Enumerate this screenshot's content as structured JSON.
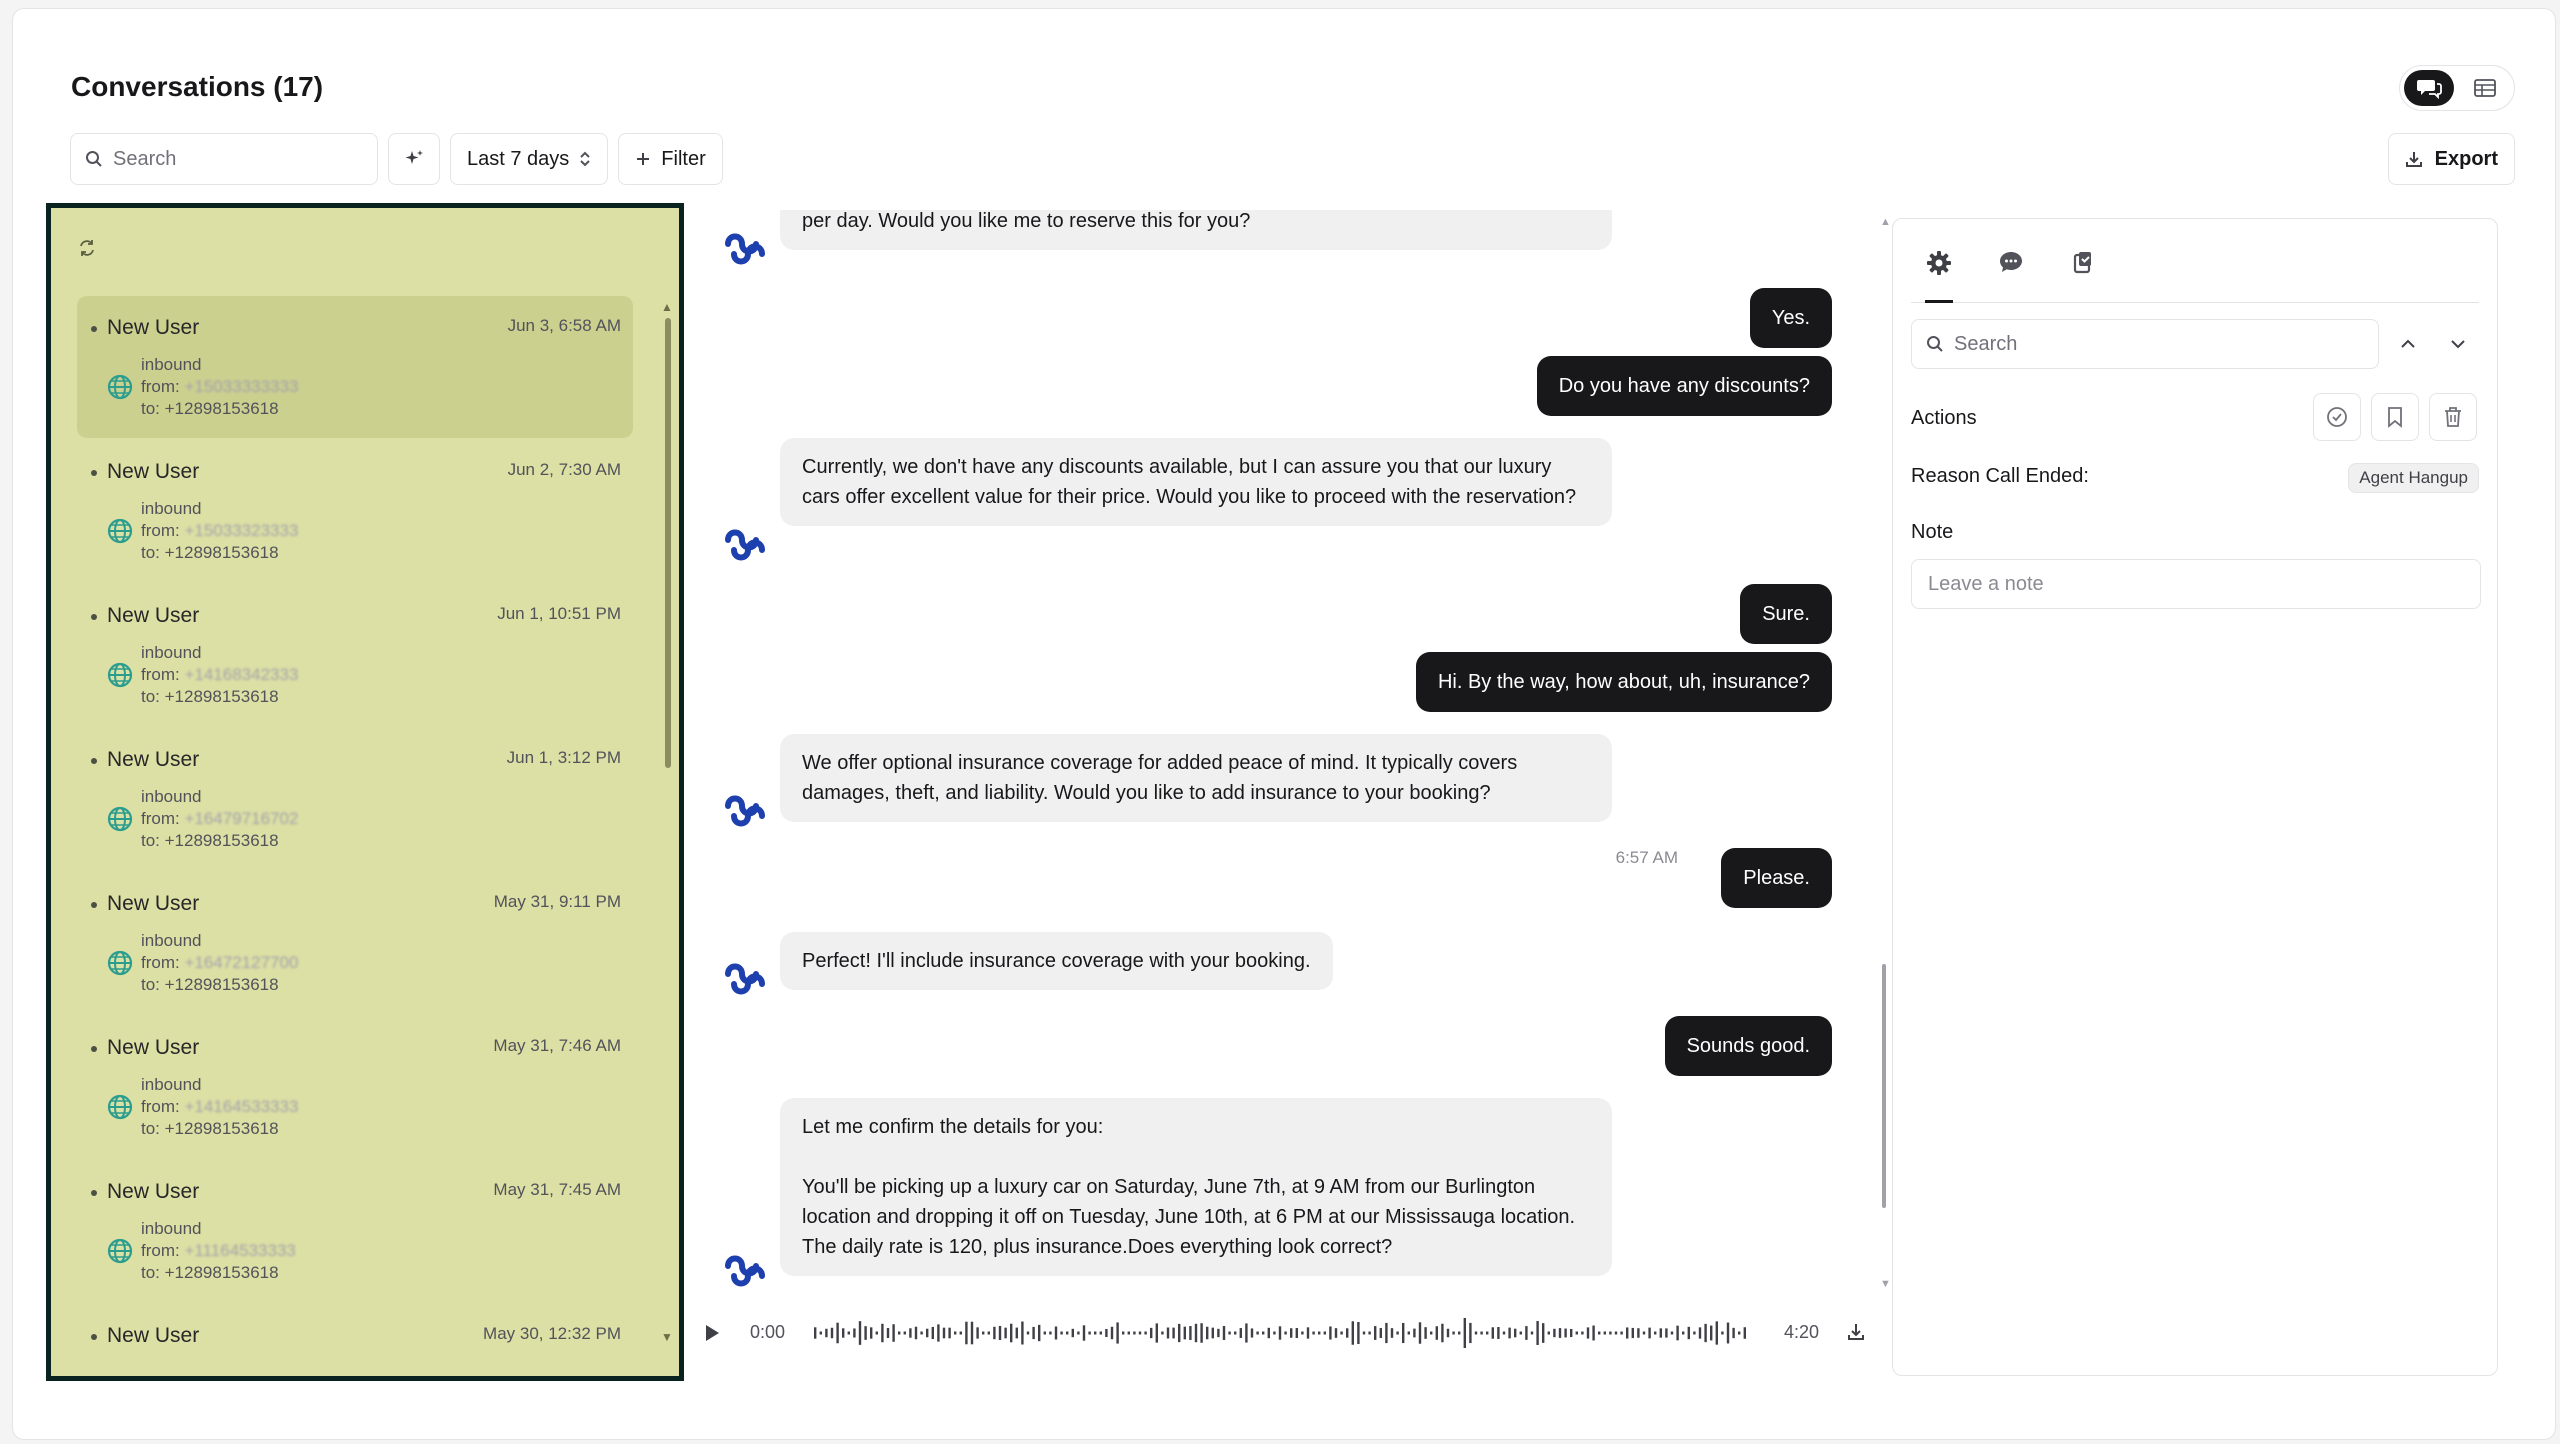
{
  "header": {
    "title": "Conversations (17)",
    "view_modes": [
      "chat-view-icon",
      "table-view-icon"
    ]
  },
  "toolbar": {
    "search_placeholder": "Search",
    "date_range": "Last 7 days",
    "filter_label": "Filter",
    "export_label": "Export"
  },
  "conversations": [
    {
      "name": "New User",
      "date": "Jun 3, 6:58 AM",
      "direction": "inbound",
      "from_label": "from:",
      "from": "+15033333333",
      "to": "to: +12898153618",
      "selected": true
    },
    {
      "name": "New User",
      "date": "Jun 2, 7:30 AM",
      "direction": "inbound",
      "from_label": "from:",
      "from": "+15033323333",
      "to": "to: +12898153618"
    },
    {
      "name": "New User",
      "date": "Jun 1, 10:51 PM",
      "direction": "inbound",
      "from_label": "from:",
      "from": "+14168342333",
      "to": "to: +12898153618"
    },
    {
      "name": "New User",
      "date": "Jun 1, 3:12 PM",
      "direction": "inbound",
      "from_label": "from:",
      "from": "+16479716702",
      "to": "to: +12898153618"
    },
    {
      "name": "New User",
      "date": "May 31, 9:11 PM",
      "direction": "inbound",
      "from_label": "from:",
      "from": "+16472127700",
      "to": "to: +12898153618"
    },
    {
      "name": "New User",
      "date": "May 31, 7:46 AM",
      "direction": "inbound",
      "from_label": "from:",
      "from": "+14164533333",
      "to": "to: +12898153618"
    },
    {
      "name": "New User",
      "date": "May 31, 7:45 AM",
      "direction": "inbound",
      "from_label": "from:",
      "from": "+11164533333",
      "to": "to: +12898153618"
    },
    {
      "name": "New User",
      "date": "May 30, 12:32 PM",
      "direction": "",
      "from_label": "",
      "from": "",
      "to": ""
    }
  ],
  "messages": {
    "m1": "per day. Would you like me to reserve this for you?",
    "m2": "Yes.",
    "m3": "Do you have any discounts?",
    "m4": "Currently, we don't have any discounts available, but I can assure you that our luxury cars offer excellent value for their price. Would you like to proceed with the reservation?",
    "m5": "Sure.",
    "m6": "Hi. By the way, how about, uh, insurance?",
    "m7": "We offer optional insurance coverage for added peace of mind. It typically covers damages, theft, and liability. Would you like to add insurance to your booking?",
    "m8_time": "6:57 AM",
    "m8": "Please.",
    "m9": "Perfect! I'll include insurance coverage with your booking.",
    "m10": "Sounds good.",
    "m11_a": "Let me confirm the details for you:",
    "m11_b": "You'll be picking up a luxury car on Saturday, June 7th, at 9 AM from our Burlington location and dropping it off on Tuesday, June 10th, at 6 PM at our Mississauga location. The daily rate is 120, plus insurance.Does everything look correct?"
  },
  "player": {
    "current": "0:00",
    "duration": "4:20",
    "progress": 0
  },
  "details": {
    "search_placeholder": "Search",
    "actions_label": "Actions",
    "reason_label": "Reason Call Ended:",
    "reason_value": "Agent Hangup",
    "note_label": "Note",
    "note_placeholder": "Leave a note"
  },
  "colors": {
    "list_bg": "#dde0a4",
    "list_border": "#0b2320",
    "user_bubble": "#18181b",
    "agent_bubble": "#f0f0f1",
    "brand_logo": "#1e40af",
    "globe": "#2a9d8f"
  }
}
